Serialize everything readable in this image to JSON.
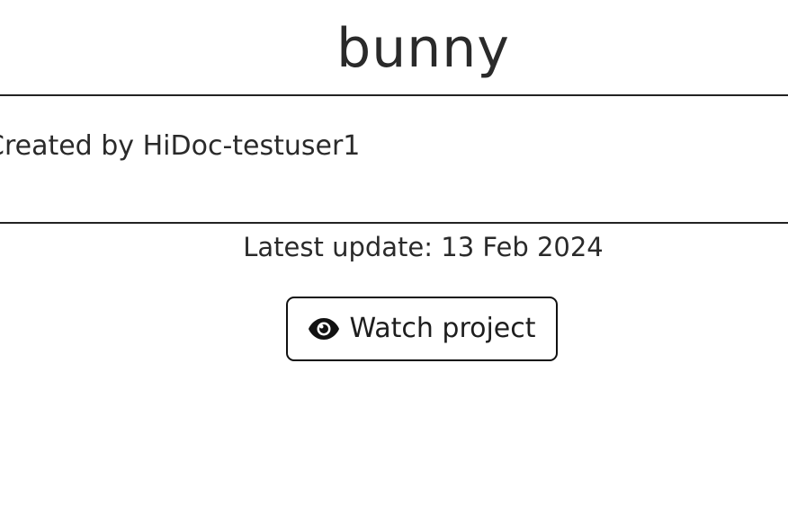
{
  "project": {
    "title": "bunny",
    "creator_text": "Created by HiDoc-testuser1",
    "latest_update": "Latest update: 13 Feb 2024"
  },
  "actions": {
    "watch_label": "Watch project",
    "watch_icon": "eye-icon"
  },
  "colors": {
    "text": "#2a2a2a",
    "divider": "#222222",
    "button_border": "#111111",
    "background": "#ffffff"
  }
}
